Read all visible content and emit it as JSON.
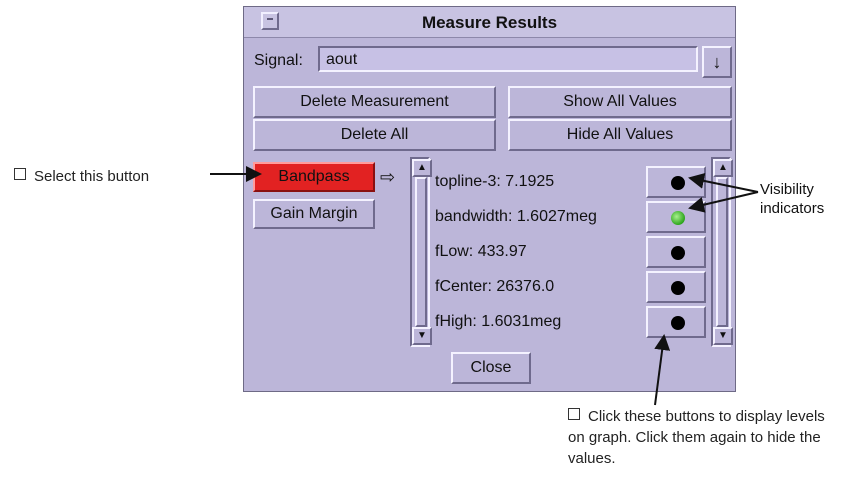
{
  "window": {
    "title": "Measure Results"
  },
  "signal": {
    "label": "Signal:",
    "value": "aout"
  },
  "buttons": {
    "delete_measurement": "Delete Measurement",
    "show_all_values": "Show All Values",
    "delete_all": "Delete All",
    "hide_all_values": "Hide All Values",
    "close": "Close"
  },
  "measurements": [
    {
      "label": "Bandpass",
      "selected": true
    },
    {
      "label": "Gain Margin",
      "selected": false
    }
  ],
  "results": [
    {
      "text": "topline-3: 7.1925",
      "visible": false
    },
    {
      "text": "bandwidth: 1.6027meg",
      "visible": true
    },
    {
      "text": "fLow: 433.97",
      "visible": false
    },
    {
      "text": "fCenter: 26376.0",
      "visible": false
    },
    {
      "text": "fHigh: 1.6031meg",
      "visible": false
    }
  ],
  "annotations": {
    "select_button": "Select this button",
    "visibility": "Visibility indicators",
    "click_note": "Click these buttons to display levels on graph. Click them again to hide the values."
  },
  "colors": {
    "window_bg": "#bcb6d9",
    "selected_button": "#e22222",
    "visible_indicator": "#49c83a"
  },
  "icons": {
    "window_menu": "window-menu-icon",
    "dropdown": "down-arrow-icon",
    "selection_arrow": "right-arrow-icon"
  }
}
